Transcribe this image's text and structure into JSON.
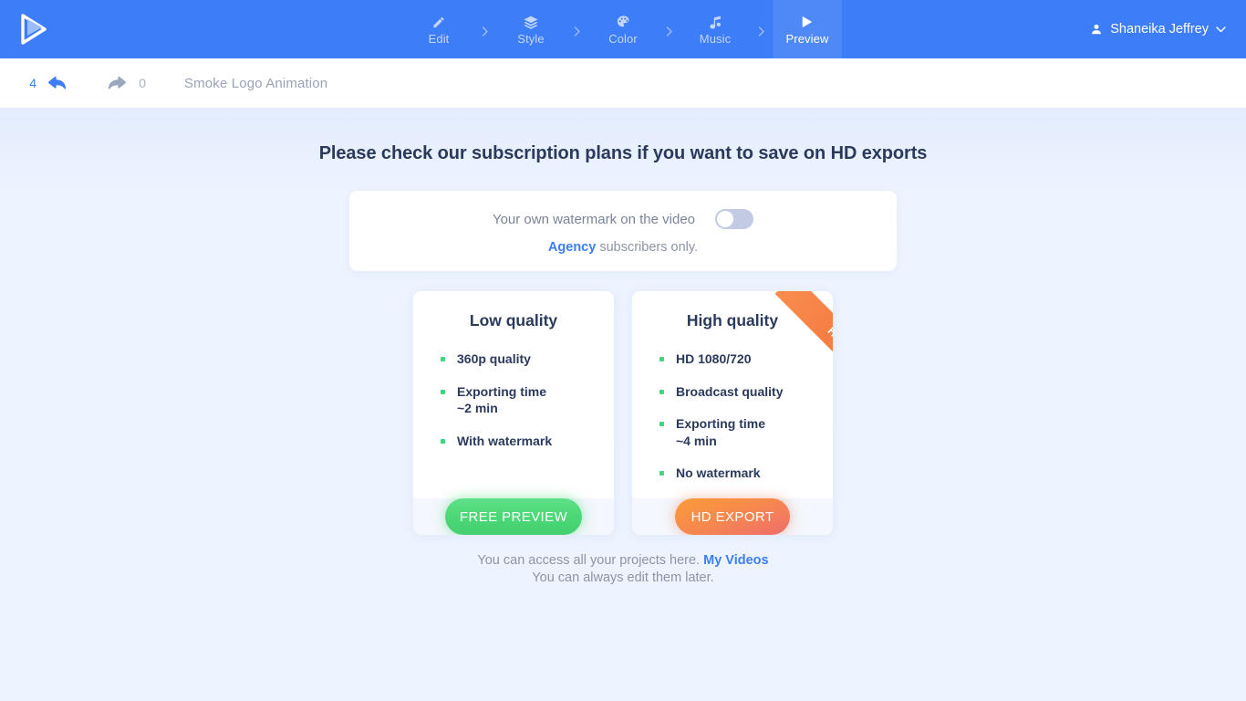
{
  "brand": {
    "logo_icon": "play-logo-icon",
    "accent": "#3d7df7"
  },
  "topbar": {
    "steps": [
      {
        "label": "Edit",
        "icon": "pencil-icon",
        "active": false
      },
      {
        "label": "Style",
        "icon": "layers-icon",
        "active": false
      },
      {
        "label": "Color",
        "icon": "palette-icon",
        "active": false
      },
      {
        "label": "Music",
        "icon": "music-note-icon",
        "active": false
      },
      {
        "label": "Preview",
        "icon": "play-icon",
        "active": true
      }
    ],
    "separator": "chevron-right-icon",
    "user": {
      "name": "Shaneika Jeffrey",
      "icon": "user-icon",
      "caret": "chevron-down-icon"
    }
  },
  "subbar": {
    "undo_count": "4",
    "redo_count": "0",
    "undo_icon": "undo-arrow-icon",
    "redo_icon": "redo-arrow-icon",
    "project_title": "Smoke Logo Animation"
  },
  "main": {
    "headline": "Please check our subscription plans if you want to save on HD exports",
    "watermark": {
      "label": "Your own watermark on the video",
      "toggle_state": "off",
      "note_link": "Agency",
      "note_rest": " subscribers only."
    },
    "plans": [
      {
        "title": "Low quality",
        "features": [
          "360p quality",
          "Exporting time\n~2 min",
          "With watermark"
        ],
        "button": "FREE PREVIEW",
        "button_style": "green",
        "ribbon": null
      },
      {
        "title": "High quality",
        "features": [
          "HD 1080/720",
          "Broadcast quality",
          "Exporting time\n~4 min",
          "No watermark"
        ],
        "button": "HD EXPORT",
        "button_style": "orange",
        "ribbon": "HD"
      }
    ],
    "footnote": {
      "line1_before": "You can access all your projects here. ",
      "line1_link": "My Videos",
      "line2": "You can always edit them later."
    }
  },
  "colors": {
    "header_blue": "#3d7df7",
    "active_step_blue": "#4f89f8",
    "page_bg": "#eef4ff",
    "bullet_green": "#3fd67f",
    "button_green": "#4cd877",
    "button_orange": "#f5793f",
    "ribbon_orange": "#f5793f",
    "heading_navy": "#2b3a5c"
  }
}
